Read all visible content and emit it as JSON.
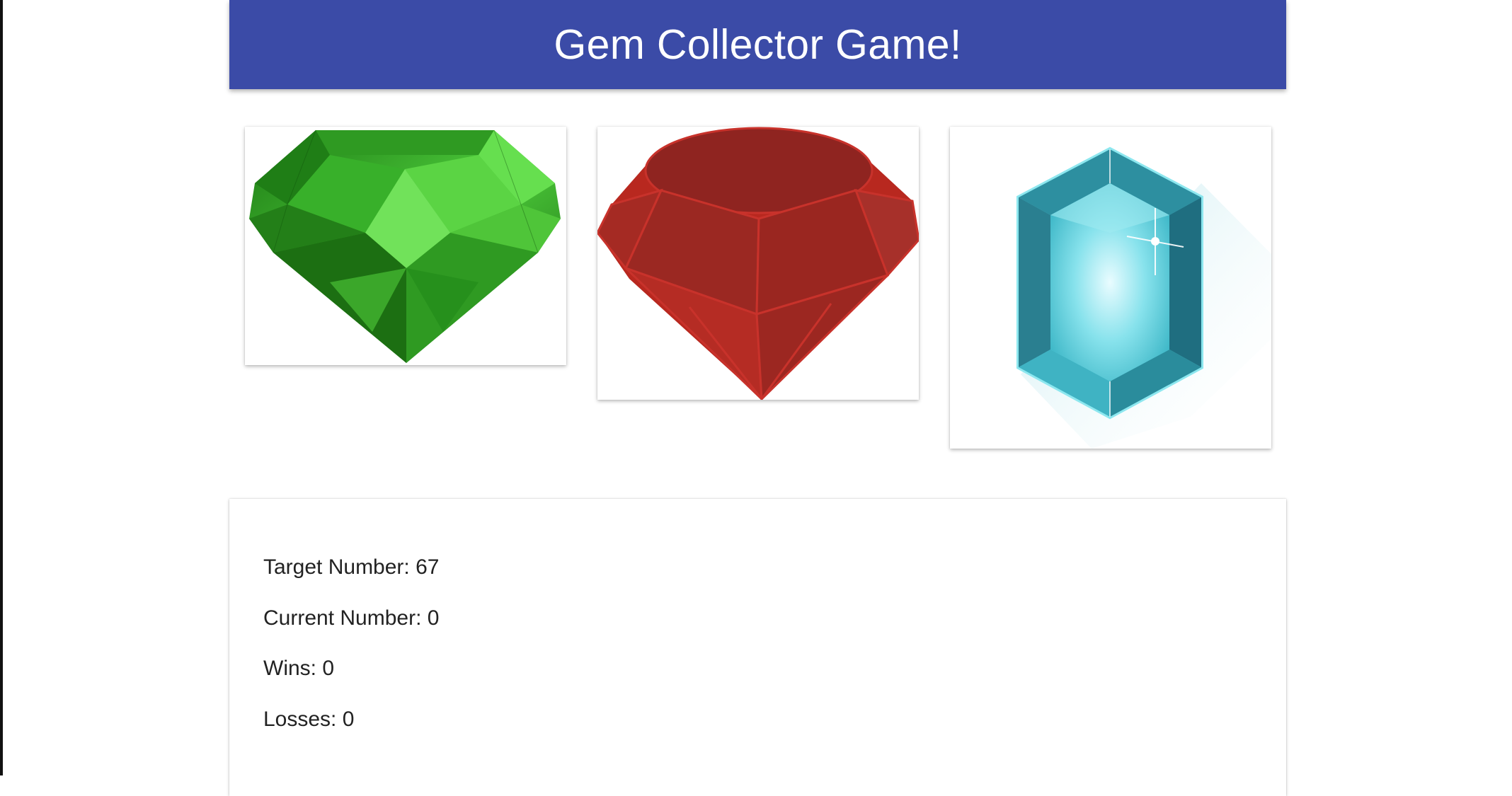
{
  "header": {
    "title": "Gem Collector Game!"
  },
  "gems": [
    {
      "name": "green-gem",
      "color": "#3fb51f"
    },
    {
      "name": "red-gem",
      "color": "#b52720"
    },
    {
      "name": "blue-gem",
      "color": "#4cc6d4"
    }
  ],
  "colors": {
    "header_bg": "#3b4ba7",
    "header_text": "#ffffff",
    "page_bg": "#ffffff"
  },
  "stats": {
    "target_label": "Target Number: ",
    "target_value": "67",
    "current_label": "Current Number: ",
    "current_value": "0",
    "wins_label": "Wins: ",
    "wins_value": "0",
    "losses_label": "Losses: ",
    "losses_value": "0"
  }
}
